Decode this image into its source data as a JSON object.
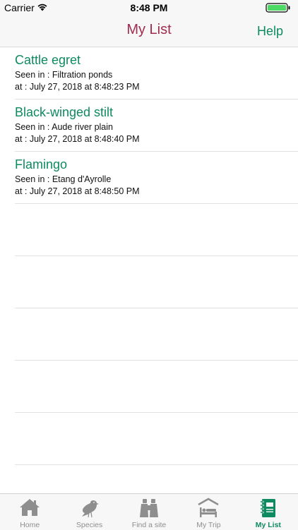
{
  "status": {
    "carrier": "Carrier",
    "time": "8:48 PM"
  },
  "nav": {
    "title": "My List",
    "help_label": "Help"
  },
  "sightings": [
    {
      "name": "Cattle egret",
      "seen": "Seen in : Filtration ponds",
      "at": "at : July 27, 2018 at 8:48:23 PM"
    },
    {
      "name": "Black-winged stilt",
      "seen": "Seen in : Aude river plain",
      "at": "at : July 27, 2018 at 8:48:40 PM"
    },
    {
      "name": "Flamingo",
      "seen": "Seen in : Etang d'Ayrolle",
      "at": "at : July 27, 2018 at 8:48:50 PM"
    }
  ],
  "tabs": [
    {
      "label": "Home",
      "icon": "home-icon"
    },
    {
      "label": "Species",
      "icon": "bird-icon"
    },
    {
      "label": "Find a site",
      "icon": "binoculars-icon"
    },
    {
      "label": "My Trip",
      "icon": "bed-icon"
    },
    {
      "label": "My List",
      "icon": "notebook-icon",
      "active": true
    }
  ],
  "colors": {
    "accent": "#0e8a60",
    "title": "#a02c50",
    "inactive_tab": "#8e8e8e"
  }
}
